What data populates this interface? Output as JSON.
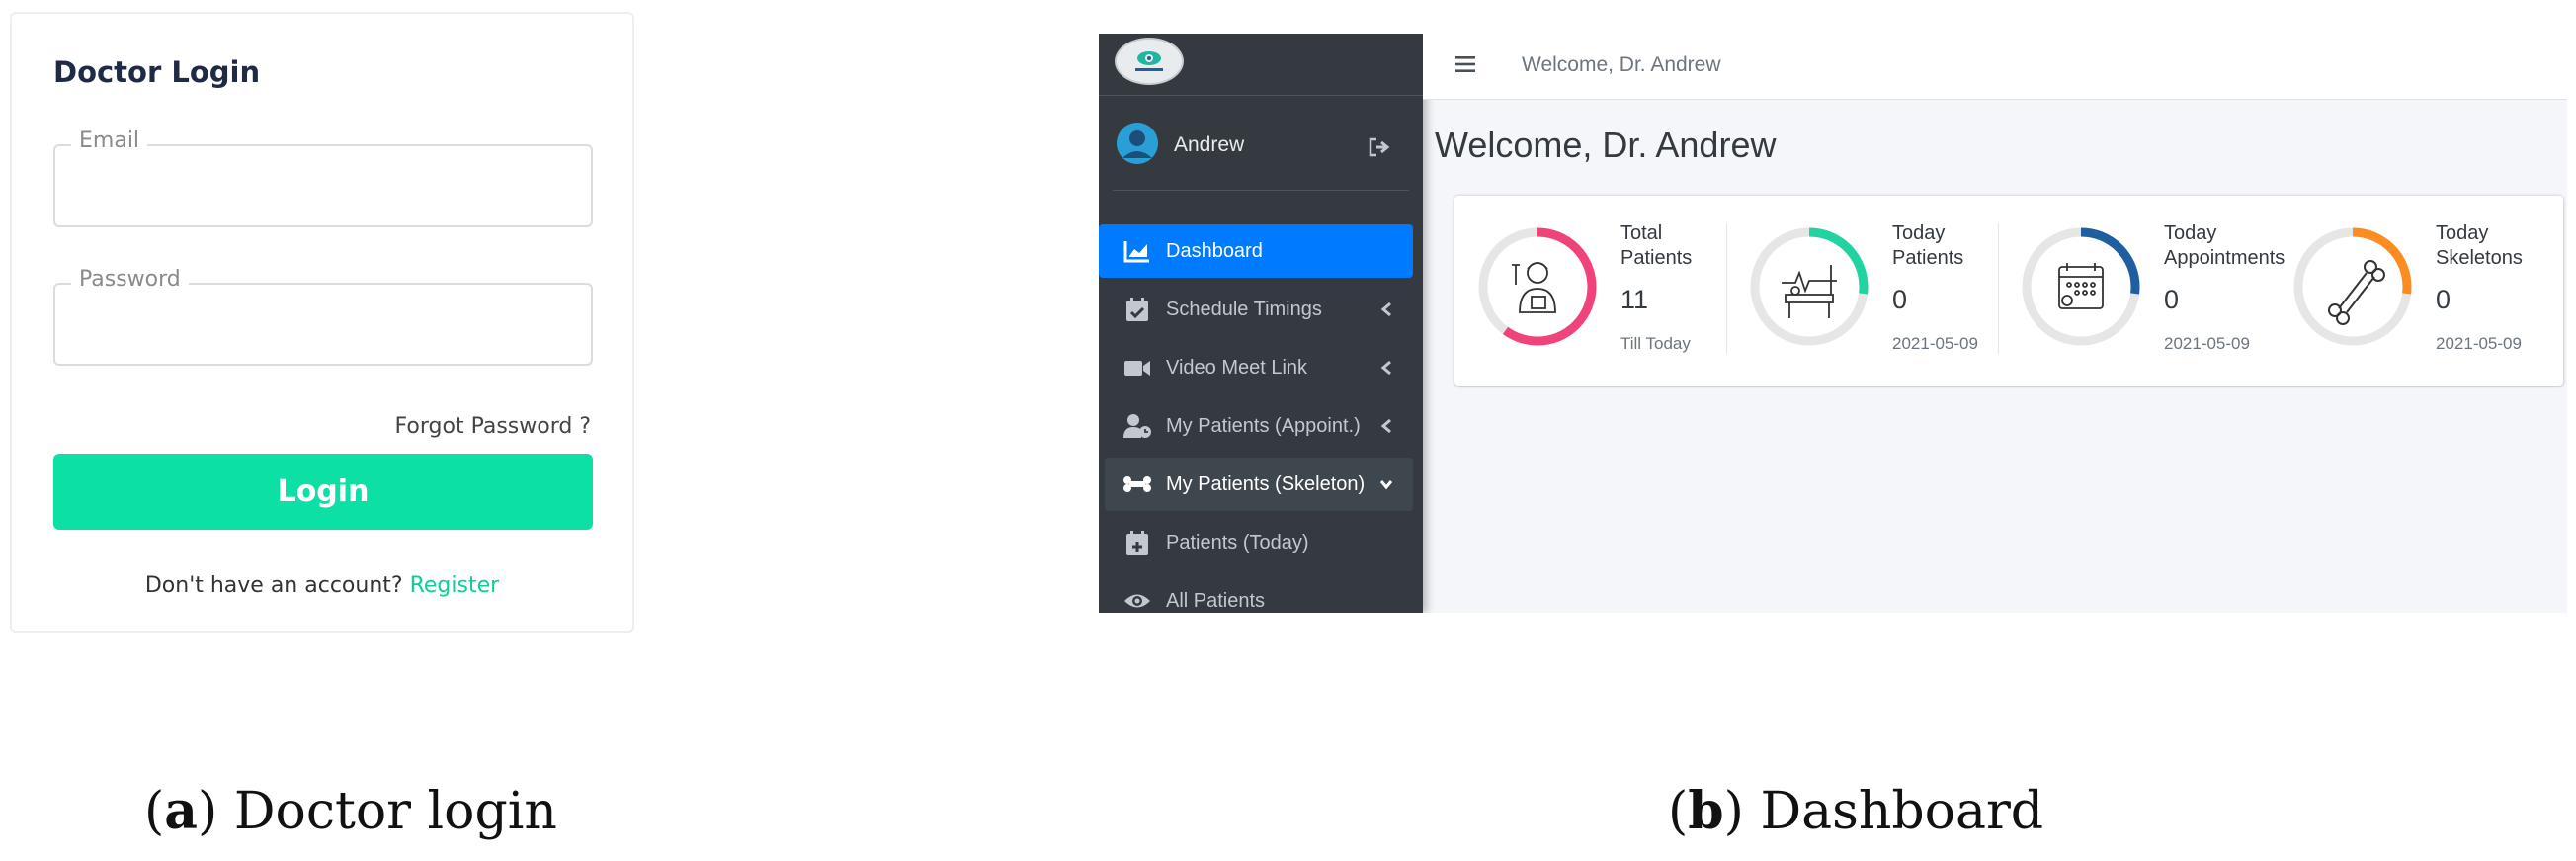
{
  "login": {
    "title": "Doctor Login",
    "email_label": "Email",
    "email_value": "",
    "password_label": "Password",
    "password_value": "",
    "forgot_password": "Forgot Password ?",
    "login_button": "Login",
    "register_prompt": "Don't have an account?",
    "register_link": "Register",
    "accent_color": "#0de0a5"
  },
  "dashboard": {
    "topbar_title": "Welcome, Dr. Andrew",
    "page_title": "Welcome, Dr. Andrew",
    "user_name": "Andrew",
    "sidebar": {
      "items": [
        {
          "label": "Dashboard",
          "icon": "chart-area-icon",
          "active": true
        },
        {
          "label": "Schedule Timings",
          "icon": "calendar-check-icon"
        },
        {
          "label": "Video Meet Link",
          "icon": "video-icon"
        },
        {
          "label": "My Patients (Appoint.)",
          "icon": "user-clock-icon"
        },
        {
          "label": "My Patients (Skeleton)",
          "icon": "bone-icon",
          "open": true
        },
        {
          "label": "Patients (Today)",
          "icon": "calendar-plus-icon"
        },
        {
          "label": "All Patients",
          "icon": "eye-icon"
        }
      ]
    },
    "stats": [
      {
        "label_line1": "Total",
        "label_line2": "Patients",
        "value": "11",
        "sub": "Till Today",
        "color": "#f0437a",
        "fill": 0.6,
        "icon": "patient-icon"
      },
      {
        "label_line1": "Today",
        "label_line2": "Patients",
        "value": "0",
        "sub": "2021-05-09",
        "color": "#20d3a0",
        "fill": 0.27,
        "icon": "hospital-bed-icon"
      },
      {
        "label_line1": "Today",
        "label_line2": "Appointments",
        "value": "0",
        "sub": "2021-05-09",
        "color": "#1f5fa0",
        "fill": 0.27,
        "icon": "calendar-icon"
      },
      {
        "label_line1": "Today",
        "label_line2": "Skeletons",
        "value": "0",
        "sub": "2021-05-09",
        "color": "#fb8c1f",
        "fill": 0.27,
        "icon": "bone-icon"
      }
    ],
    "sidebar_color": "#343a40",
    "active_color": "#007bff"
  },
  "captions": {
    "a_letter": "a",
    "a_text": "Doctor login",
    "b_letter": "b",
    "b_text": "Dashboard"
  }
}
